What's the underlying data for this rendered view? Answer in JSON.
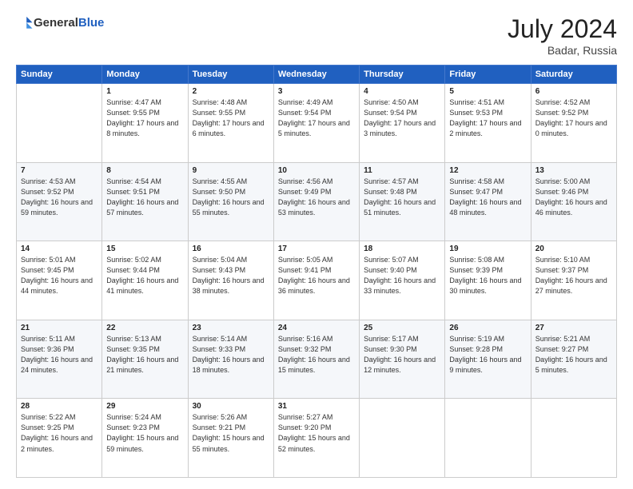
{
  "logo": {
    "general": "General",
    "blue": "Blue"
  },
  "title": "July 2024",
  "location": "Badar, Russia",
  "days_of_week": [
    "Sunday",
    "Monday",
    "Tuesday",
    "Wednesday",
    "Thursday",
    "Friday",
    "Saturday"
  ],
  "weeks": [
    [
      {
        "day": "",
        "info": ""
      },
      {
        "day": "1",
        "info": "Sunrise: 4:47 AM\nSunset: 9:55 PM\nDaylight: 17 hours\nand 8 minutes."
      },
      {
        "day": "2",
        "info": "Sunrise: 4:48 AM\nSunset: 9:55 PM\nDaylight: 17 hours\nand 6 minutes."
      },
      {
        "day": "3",
        "info": "Sunrise: 4:49 AM\nSunset: 9:54 PM\nDaylight: 17 hours\nand 5 minutes."
      },
      {
        "day": "4",
        "info": "Sunrise: 4:50 AM\nSunset: 9:54 PM\nDaylight: 17 hours\nand 3 minutes."
      },
      {
        "day": "5",
        "info": "Sunrise: 4:51 AM\nSunset: 9:53 PM\nDaylight: 17 hours\nand 2 minutes."
      },
      {
        "day": "6",
        "info": "Sunrise: 4:52 AM\nSunset: 9:52 PM\nDaylight: 17 hours\nand 0 minutes."
      }
    ],
    [
      {
        "day": "7",
        "info": "Sunrise: 4:53 AM\nSunset: 9:52 PM\nDaylight: 16 hours\nand 59 minutes."
      },
      {
        "day": "8",
        "info": "Sunrise: 4:54 AM\nSunset: 9:51 PM\nDaylight: 16 hours\nand 57 minutes."
      },
      {
        "day": "9",
        "info": "Sunrise: 4:55 AM\nSunset: 9:50 PM\nDaylight: 16 hours\nand 55 minutes."
      },
      {
        "day": "10",
        "info": "Sunrise: 4:56 AM\nSunset: 9:49 PM\nDaylight: 16 hours\nand 53 minutes."
      },
      {
        "day": "11",
        "info": "Sunrise: 4:57 AM\nSunset: 9:48 PM\nDaylight: 16 hours\nand 51 minutes."
      },
      {
        "day": "12",
        "info": "Sunrise: 4:58 AM\nSunset: 9:47 PM\nDaylight: 16 hours\nand 48 minutes."
      },
      {
        "day": "13",
        "info": "Sunrise: 5:00 AM\nSunset: 9:46 PM\nDaylight: 16 hours\nand 46 minutes."
      }
    ],
    [
      {
        "day": "14",
        "info": "Sunrise: 5:01 AM\nSunset: 9:45 PM\nDaylight: 16 hours\nand 44 minutes."
      },
      {
        "day": "15",
        "info": "Sunrise: 5:02 AM\nSunset: 9:44 PM\nDaylight: 16 hours\nand 41 minutes."
      },
      {
        "day": "16",
        "info": "Sunrise: 5:04 AM\nSunset: 9:43 PM\nDaylight: 16 hours\nand 38 minutes."
      },
      {
        "day": "17",
        "info": "Sunrise: 5:05 AM\nSunset: 9:41 PM\nDaylight: 16 hours\nand 36 minutes."
      },
      {
        "day": "18",
        "info": "Sunrise: 5:07 AM\nSunset: 9:40 PM\nDaylight: 16 hours\nand 33 minutes."
      },
      {
        "day": "19",
        "info": "Sunrise: 5:08 AM\nSunset: 9:39 PM\nDaylight: 16 hours\nand 30 minutes."
      },
      {
        "day": "20",
        "info": "Sunrise: 5:10 AM\nSunset: 9:37 PM\nDaylight: 16 hours\nand 27 minutes."
      }
    ],
    [
      {
        "day": "21",
        "info": "Sunrise: 5:11 AM\nSunset: 9:36 PM\nDaylight: 16 hours\nand 24 minutes."
      },
      {
        "day": "22",
        "info": "Sunrise: 5:13 AM\nSunset: 9:35 PM\nDaylight: 16 hours\nand 21 minutes."
      },
      {
        "day": "23",
        "info": "Sunrise: 5:14 AM\nSunset: 9:33 PM\nDaylight: 16 hours\nand 18 minutes."
      },
      {
        "day": "24",
        "info": "Sunrise: 5:16 AM\nSunset: 9:32 PM\nDaylight: 16 hours\nand 15 minutes."
      },
      {
        "day": "25",
        "info": "Sunrise: 5:17 AM\nSunset: 9:30 PM\nDaylight: 16 hours\nand 12 minutes."
      },
      {
        "day": "26",
        "info": "Sunrise: 5:19 AM\nSunset: 9:28 PM\nDaylight: 16 hours\nand 9 minutes."
      },
      {
        "day": "27",
        "info": "Sunrise: 5:21 AM\nSunset: 9:27 PM\nDaylight: 16 hours\nand 5 minutes."
      }
    ],
    [
      {
        "day": "28",
        "info": "Sunrise: 5:22 AM\nSunset: 9:25 PM\nDaylight: 16 hours\nand 2 minutes."
      },
      {
        "day": "29",
        "info": "Sunrise: 5:24 AM\nSunset: 9:23 PM\nDaylight: 15 hours\nand 59 minutes."
      },
      {
        "day": "30",
        "info": "Sunrise: 5:26 AM\nSunset: 9:21 PM\nDaylight: 15 hours\nand 55 minutes."
      },
      {
        "day": "31",
        "info": "Sunrise: 5:27 AM\nSunset: 9:20 PM\nDaylight: 15 hours\nand 52 minutes."
      },
      {
        "day": "",
        "info": ""
      },
      {
        "day": "",
        "info": ""
      },
      {
        "day": "",
        "info": ""
      }
    ]
  ]
}
